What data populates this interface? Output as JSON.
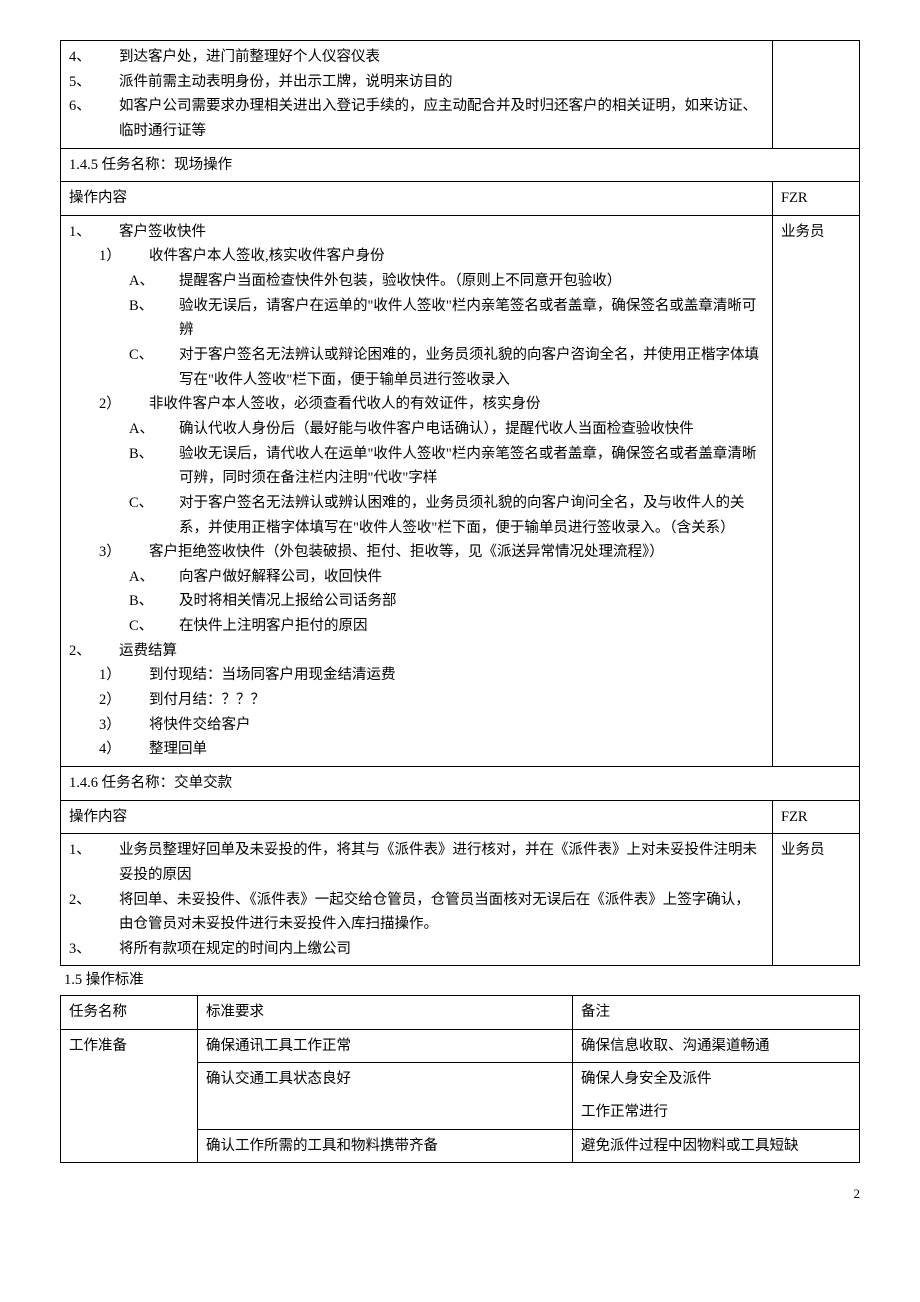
{
  "tableA": {
    "preItems": [
      {
        "num": "4、",
        "text": "到达客户处，进门前整理好个人仪容仪表"
      },
      {
        "num": "5、",
        "text": "派件前需主动表明身份，并出示工牌，说明来访目的"
      },
      {
        "num": "6、",
        "text": "如客户公司需要求办理相关进出入登记手续的，应主动配合并及时归还客户的相关证明，如来访证、临时通行证等"
      }
    ],
    "section145": {
      "title": "1.4.5 任务名称：现场操作",
      "headerLeft": "操作内容",
      "headerRight": "FZR",
      "fzr": "业务员",
      "item1": {
        "num": "1、",
        "label": "客户签收快件",
        "sub1": {
          "num": "1）",
          "label": "收件客户本人签收,核实收件客户身份",
          "a": {
            "num": "A、",
            "text": "提醒客户当面检查快件外包装，验收快件。（原则上不同意开包验收）"
          },
          "b": {
            "num": "B、",
            "text": "验收无误后，请客户在运单的\"收件人签收\"栏内亲笔签名或者盖章，确保签名或盖章清晰可辨"
          },
          "c": {
            "num": "C、",
            "text": "对于客户签名无法辨认或辩论困难的，业务员须礼貌的向客户咨询全名，并使用正楷字体填写在\"收件人签收\"栏下面，便于输单员进行签收录入"
          }
        },
        "sub2": {
          "num": "2）",
          "label": "非收件客户本人签收，必须查看代收人的有效证件，核实身份",
          "a": {
            "num": "A、",
            "text": "确认代收人身份后（最好能与收件客户电话确认），提醒代收人当面检查验收快件"
          },
          "b": {
            "num": "B、",
            "text": "验收无误后，请代收人在运单\"收件人签收\"栏内亲笔签名或者盖章，确保签名或者盖章清晰可辨，同时须在备注栏内注明\"代收\"字样"
          },
          "c": {
            "num": "C、",
            "text": "对于客户签名无法辨认或辨认困难的，业务员须礼貌的向客户询问全名，及与收件人的关系，并使用正楷字体填写在\"收件人签收\"栏下面，便于输单员进行签收录入。（含关系）"
          }
        },
        "sub3": {
          "num": "3）",
          "label": "客户拒绝签收快件（外包装破损、拒付、拒收等，见《派送异常情况处理流程》）",
          "a": {
            "num": "A、",
            "text": "向客户做好解释公司，收回快件"
          },
          "b": {
            "num": "B、",
            "text": "及时将相关情况上报给公司话务部"
          },
          "c": {
            "num": "C、",
            "text": "在快件上注明客户拒付的原因"
          }
        }
      },
      "item2": {
        "num": "2、",
        "label": "运费结算",
        "s1": {
          "num": "1）",
          "text": "到付现结：当场同客户用现金结清运费"
        },
        "s2": {
          "num": "2）",
          "text": "到付月结：？？？"
        },
        "s3": {
          "num": "3）",
          "text": "将快件交给客户"
        },
        "s4": {
          "num": "4）",
          "text": "整理回单"
        }
      }
    },
    "section146": {
      "title": "1.4.6 任务名称：交单交款",
      "headerLeft": "操作内容",
      "headerRight": "FZR",
      "fzr": "业务员",
      "items": [
        {
          "num": "1、",
          "text": "业务员整理好回单及未妥投的件，将其与《派件表》进行核对，并在《派件表》上对未妥投件注明未妥投的原因"
        },
        {
          "num": "2、",
          "text": "将回单、未妥投件、《派件表》一起交给仓管员，仓管员当面核对无误后在《派件表》上签字确认，由仓管员对未妥投件进行未妥投件入库扫描操作。"
        },
        {
          "num": "3、",
          "text": "将所有款项在规定的时间内上缴公司"
        }
      ]
    }
  },
  "section15Title": "1.5 操作标准",
  "tableB": {
    "header": {
      "c1": "任务名称",
      "c2": "标准要求",
      "c3": "备注"
    },
    "rows": [
      {
        "c1": "工作准备",
        "c2": "确保通讯工具工作正常",
        "c3": "确保信息收取、沟通渠道畅通"
      },
      {
        "c1": "",
        "c2": "确认交通工具状态良好",
        "c3": "确保人身安全及派件"
      },
      {
        "c1": "",
        "c2": "",
        "c3": "工作正常进行"
      },
      {
        "c1": "",
        "c2": "确认工作所需的工具和物料携带齐备",
        "c3": "避免派件过程中因物料或工具短缺"
      }
    ]
  },
  "pageNumber": "2"
}
